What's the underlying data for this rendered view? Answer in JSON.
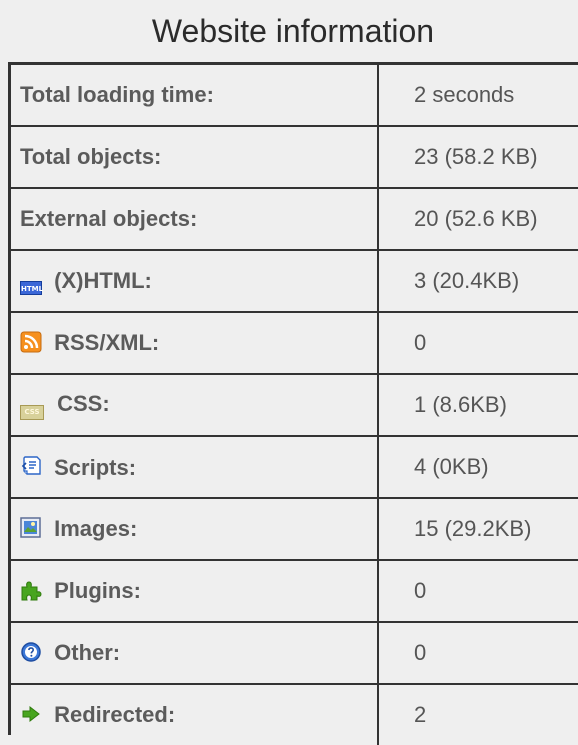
{
  "title": "Website information",
  "rows": [
    {
      "label": "Total loading time:",
      "value": "2 seconds",
      "icon": ""
    },
    {
      "label": "Total objects:",
      "value": "23 (58.2 KB)",
      "icon": ""
    },
    {
      "label": "External objects:",
      "value": "20 (52.6 KB)",
      "icon": ""
    },
    {
      "label": "(X)HTML:",
      "value": "3 (20.4KB)",
      "icon": "html-icon"
    },
    {
      "label": "RSS/XML:",
      "value": "0",
      "icon": "rss-icon"
    },
    {
      "label": "CSS:",
      "value": "1 (8.6KB)",
      "icon": "css-icon"
    },
    {
      "label": "Scripts:",
      "value": "4 (0KB)",
      "icon": "script-icon"
    },
    {
      "label": "Images:",
      "value": "15 (29.2KB)",
      "icon": "image-icon"
    },
    {
      "label": "Plugins:",
      "value": "0",
      "icon": "plugin-icon"
    },
    {
      "label": "Other:",
      "value": "0",
      "icon": "other-help-icon"
    },
    {
      "label": "Redirected:",
      "value": "2",
      "icon": "redirect-arrow-icon"
    }
  ],
  "icon_text": {
    "html": "HTML",
    "css": "CSS"
  },
  "colors": {
    "background": "#efefef",
    "border": "#333333",
    "label_text": "#5b5b5b",
    "value_text": "#555555",
    "html_blue": "#3b67d7",
    "rss_orange": "#f6901e",
    "plugin_green": "#48a51f",
    "redirect_green": "#48a51f"
  }
}
